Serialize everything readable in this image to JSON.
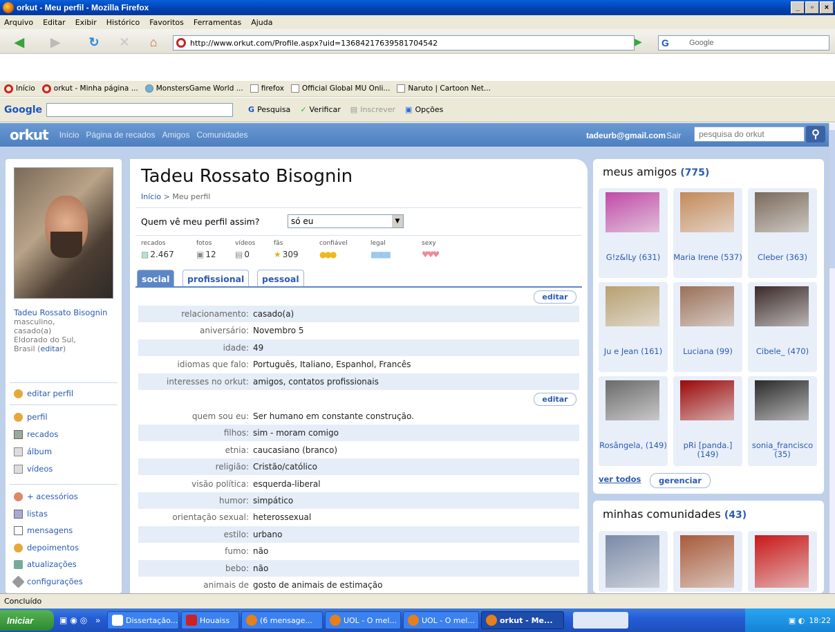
{
  "window": {
    "title": "orkut - Meu perfil - Mozilla Firefox"
  },
  "menu": [
    "Arquivo",
    "Editar",
    "Exibir",
    "Histórico",
    "Favoritos",
    "Ferramentas",
    "Ajuda"
  ],
  "nav": {
    "url": "http://www.orkut.com/Profile.aspx?uid=13684217639581704542",
    "search_placeholder": "Google"
  },
  "bookmarks": [
    "Início",
    "orkut - Minha página ...",
    "MonstersGame World ...",
    "firefox",
    "Official Global MU Onli...",
    "Naruto | Cartoon Net..."
  ],
  "google_toolbar": {
    "logo": "Google",
    "search": "Pesquisa",
    "check": "Verificar",
    "subscribe": "Inscrever",
    "options": "Opções"
  },
  "orkut": {
    "logo": "orkut",
    "nav": [
      "Início",
      "Página de recados",
      "Amigos",
      "Comunidades"
    ],
    "user_email": "tadeurb@gmail.com",
    "logout": "Sair",
    "search_placeholder": "pesquisa do orkut"
  },
  "left": {
    "name": "Tadeu Rossato Bisognin",
    "info1": "masculino,",
    "info2": "casado(a)",
    "info3": "Eldorado do Sul,",
    "info4": "Brasil",
    "edit": "editar",
    "edit_profile": "editar perfil",
    "menu1": [
      "perfil",
      "recados",
      "álbum",
      "vídeos"
    ],
    "menu2": [
      "+ acessórios",
      "listas",
      "mensagens",
      "depoimentos",
      "atualizações",
      "configurações"
    ]
  },
  "profile": {
    "name": "Tadeu Rossato Bisognin",
    "crumb_home": "Início",
    "crumb_current": "> Meu perfil",
    "who_sees": "Quem vê meu perfil assim?",
    "who_sees_value": "só eu",
    "stats": {
      "recados_label": "recados",
      "recados": "2.467",
      "fotos_label": "fotos",
      "fotos": "12",
      "videos_label": "vídeos",
      "videos": "0",
      "fas_label": "fãs",
      "fas": "309",
      "confiavel": "confiável",
      "legal": "legal",
      "sexy": "sexy"
    },
    "tabs": [
      "social",
      "profissional",
      "pessoal"
    ],
    "edit": "editar",
    "rows1": [
      {
        "k": "relacionamento:",
        "v": "casado(a)"
      },
      {
        "k": "aniversário:",
        "v": "Novembro 5"
      },
      {
        "k": "idade:",
        "v": "49"
      },
      {
        "k": "idiomas que falo:",
        "v": "Português, Italiano, Espanhol, Francês"
      },
      {
        "k": "interesses no orkut:",
        "v": "amigos, contatos profissionais"
      }
    ],
    "rows2": [
      {
        "k": "quem sou eu:",
        "v": "Ser humano em constante construção."
      },
      {
        "k": "filhos:",
        "v": "sim - moram comigo"
      },
      {
        "k": "etnia:",
        "v": "caucasiano (branco)"
      },
      {
        "k": "religião:",
        "v": "Cristão/católico"
      },
      {
        "k": "visão política:",
        "v": "esquerda-liberal"
      },
      {
        "k": "humor:",
        "v": "simpático"
      },
      {
        "k": "orientação sexual:",
        "v": "heterossexual"
      },
      {
        "k": "estilo:",
        "v": "urbano"
      },
      {
        "k": "fumo:",
        "v": "não"
      },
      {
        "k": "bebo:",
        "v": "não"
      },
      {
        "k": "animais de",
        "v": "gosto de animais de estimação"
      }
    ]
  },
  "friends": {
    "title": "meus amigos",
    "count": "(775)",
    "list": [
      {
        "name": "G!z&lLy (631)",
        "color": "#c04aa8"
      },
      {
        "name": "Maria Irene (537)",
        "color": "#c48a5a"
      },
      {
        "name": "Cleber (363)",
        "color": "#7a6a5a"
      },
      {
        "name": "Ju e Jean (161)",
        "color": "#b8a070"
      },
      {
        "name": "Luciana (99)",
        "color": "#9a7058"
      },
      {
        "name": "Cibele_ (470)",
        "color": "#3a2a28"
      },
      {
        "name": "Rosângela, (149)",
        "color": "#6a6a6a"
      },
      {
        "name": "pRi [panda.] (149)",
        "color": "#9a0808"
      },
      {
        "name": "sonia_francisco (35)",
        "color": "#2a2a2a"
      }
    ],
    "see_all": "ver todos",
    "manage": "gerenciar"
  },
  "communities": {
    "title": "minhas comunidades",
    "count": "(43)",
    "colors": [
      "#7a8aa8",
      "#a85a3a",
      "#c81818"
    ]
  },
  "status": "Concluído",
  "taskbar": {
    "start": "Iniciar",
    "items": [
      "Dissertação...",
      "Houaiss",
      "(6 mensage...",
      "UOL - O mel...",
      "UOL - O mel...",
      "orkut - Me..."
    ],
    "clock": "18:22"
  }
}
